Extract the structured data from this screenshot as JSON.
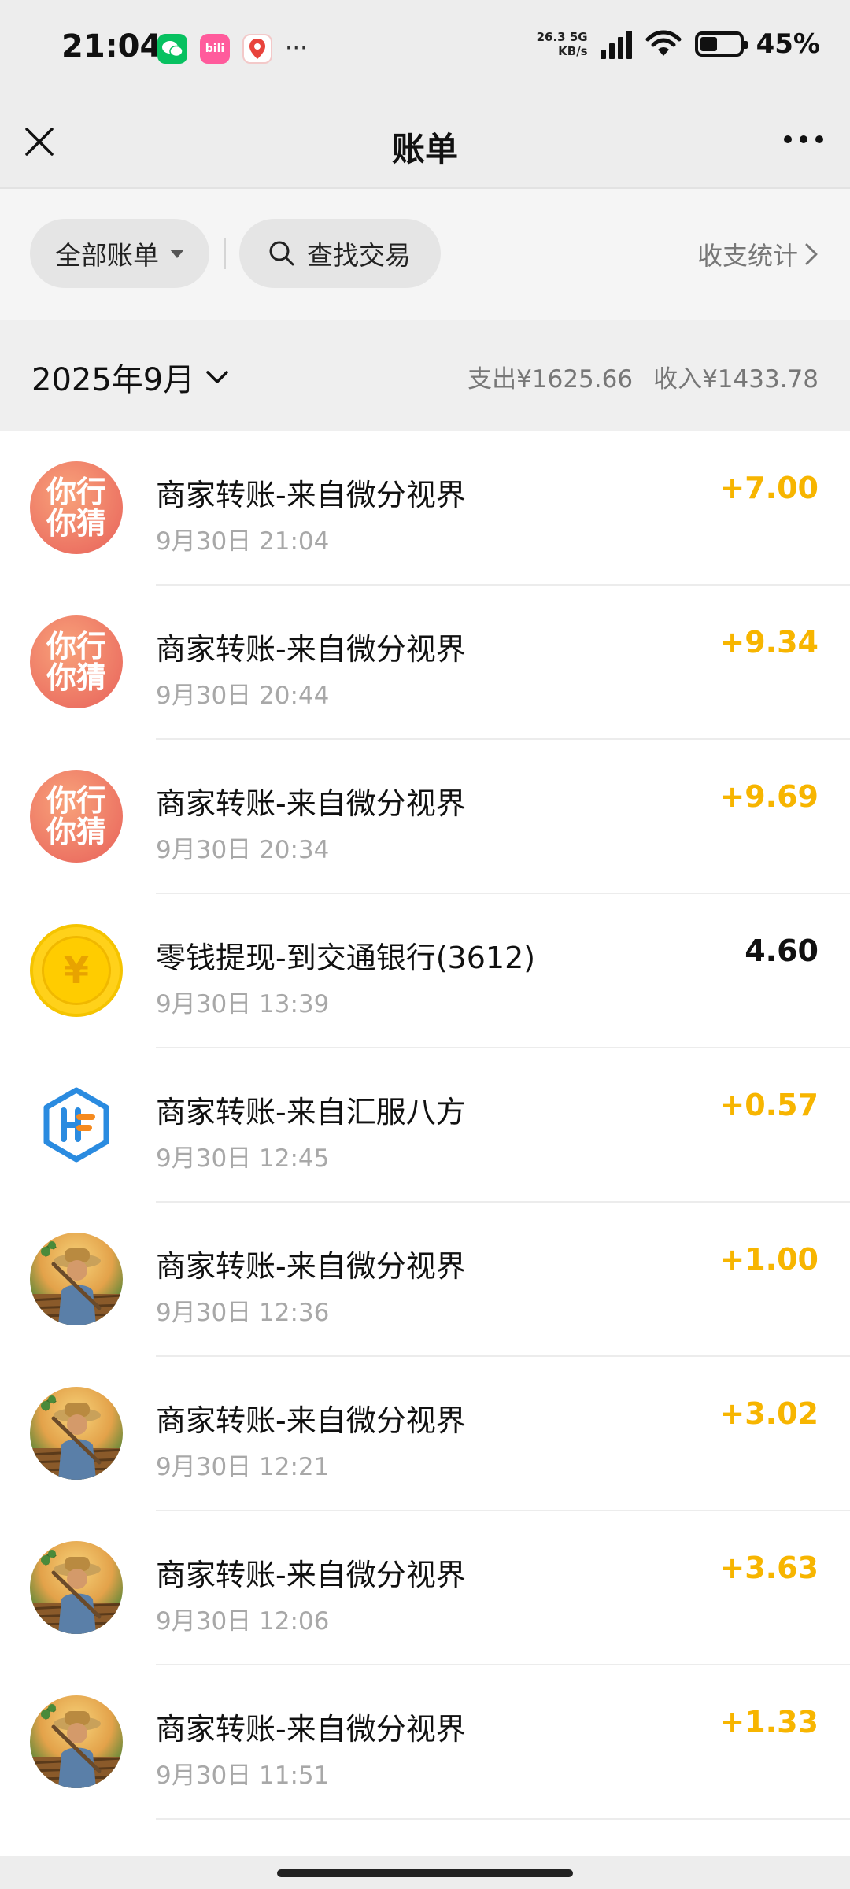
{
  "status_bar": {
    "time": "21:04",
    "apps": [
      "wechat-icon",
      "bilibili-icon",
      "map-icon"
    ],
    "bili_label": "bili",
    "more": "···",
    "net_speed_value": "26.3",
    "net_speed_unit": "KB/s",
    "network": "5G",
    "battery_percent": 45,
    "battery_label": "45%"
  },
  "nav": {
    "title": "账单"
  },
  "filters": {
    "all_bills_label": "全部账单",
    "search_label": "查找交易",
    "stats_label": "收支统计"
  },
  "month": {
    "label": "2025年9月",
    "expense": "支出¥1625.66",
    "income": "收入¥1433.78"
  },
  "avatars": {
    "guess_line1": "你行",
    "guess_line2": "你猜",
    "yuan_symbol": "¥"
  },
  "transactions": [
    {
      "avatar": "guess",
      "title": "商家转账-来自微分视界",
      "time": "9月30日 21:04",
      "amount": "+7.00",
      "direction": "in"
    },
    {
      "avatar": "guess",
      "title": "商家转账-来自微分视界",
      "time": "9月30日 20:44",
      "amount": "+9.34",
      "direction": "in"
    },
    {
      "avatar": "guess",
      "title": "商家转账-来自微分视界",
      "time": "9月30日 20:34",
      "amount": "+9.69",
      "direction": "in"
    },
    {
      "avatar": "yuan",
      "title": "零钱提现-到交通银行(3612)",
      "time": "9月30日 13:39",
      "amount": "4.60",
      "direction": "out"
    },
    {
      "avatar": "hf",
      "title": "商家转账-来自汇服八方",
      "time": "9月30日 12:45",
      "amount": "+0.57",
      "direction": "in"
    },
    {
      "avatar": "farmer",
      "title": "商家转账-来自微分视界",
      "time": "9月30日 12:36",
      "amount": "+1.00",
      "direction": "in"
    },
    {
      "avatar": "farmer",
      "title": "商家转账-来自微分视界",
      "time": "9月30日 12:21",
      "amount": "+3.02",
      "direction": "in"
    },
    {
      "avatar": "farmer",
      "title": "商家转账-来自微分视界",
      "time": "9月30日 12:06",
      "amount": "+3.63",
      "direction": "in"
    },
    {
      "avatar": "farmer",
      "title": "商家转账-来自微分视界",
      "time": "9月30日 11:51",
      "amount": "+1.33",
      "direction": "in"
    }
  ],
  "colors": {
    "income": "#f7b500",
    "expense": "#111111",
    "background": "#ededed",
    "wechat_green": "#07c160"
  }
}
